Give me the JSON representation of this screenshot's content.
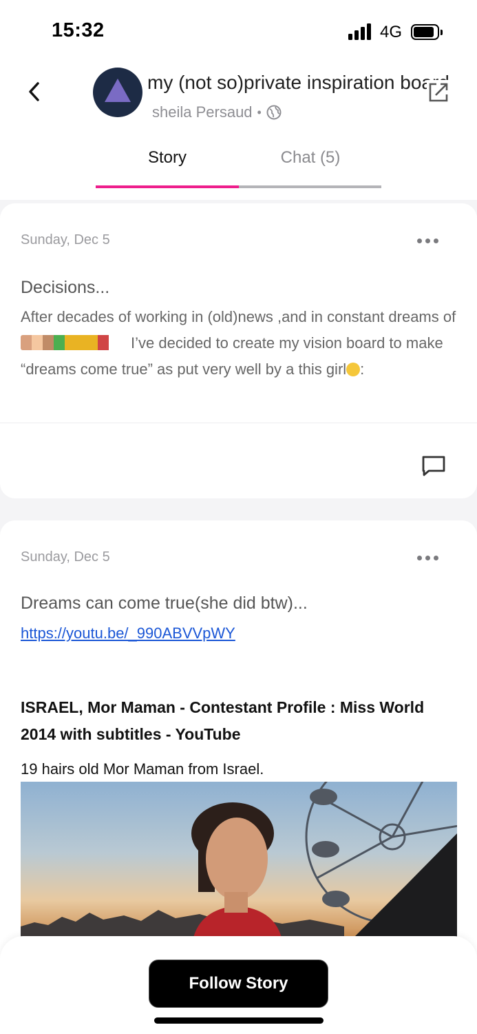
{
  "status_bar": {
    "time": "15:32",
    "network": "4G"
  },
  "header": {
    "title": "my (not so)private inspiration board",
    "author": "sheila Persaud",
    "separator": "•",
    "visibility_icon": "globe-icon",
    "share_icon": "share-icon",
    "back_icon": "chevron-left-icon"
  },
  "tabs": [
    {
      "label": "Story",
      "active": true
    },
    {
      "label": "Chat (5)",
      "active": false
    }
  ],
  "colors": {
    "accent": "#ee1e8c",
    "link": "#1a56d6",
    "avatar_bg": "#1d2b45",
    "avatar_mark": "#7a6bc4"
  },
  "posts": [
    {
      "date": "Sunday, Dec 5",
      "heading": "Decisions...",
      "body_part1": "After decades of working in (old)news ,and in constant dreams of ",
      "body_part2": "I’ve decided to create my vision board to make “dreams come true” as put very well by a this girl",
      "body_part3": ":",
      "emojis": "👣🧘🤸☘️👯👯💃",
      "laugh_emoji": "🤣"
    },
    {
      "date": "Sunday, Dec 5",
      "heading": "Dreams can come true(she did btw)...",
      "link": "https://youtu.be/_990ABVVpWY",
      "preview_title": "ISRAEL, Mor Maman - Contestant Profile : Miss World 2014 with subtitles - YouTube",
      "preview_description": "19 hairs old Mor Maman from Israel."
    }
  ],
  "footer": {
    "follow_label": "Follow Story"
  }
}
